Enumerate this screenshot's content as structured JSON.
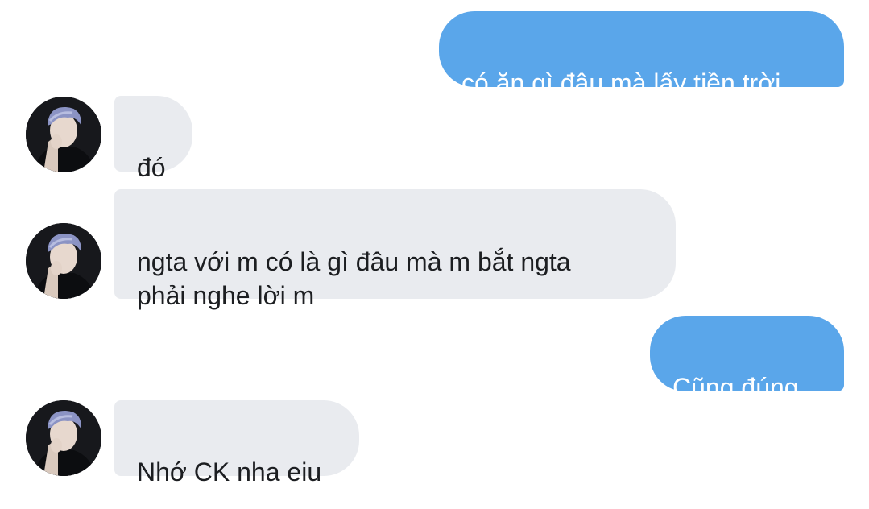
{
  "chat": {
    "messages": [
      {
        "direction": "outgoing",
        "text": "có ăn gì đâu mà lấy tiền trời"
      },
      {
        "direction": "incoming",
        "text": "đó"
      },
      {
        "direction": "incoming",
        "text": "ngta với m có là gì đâu mà m bắt ngta\nphải nghe lời m"
      },
      {
        "direction": "outgoing",
        "text": "Cũng đúng"
      },
      {
        "direction": "incoming",
        "text": "Nhớ CK nha eiu"
      }
    ]
  },
  "contact": {
    "avatar_icon": "contact-avatar-photo"
  },
  "colors": {
    "outgoing_bubble": "#5aa6ea",
    "incoming_bubble": "#e9ebef",
    "outgoing_text": "#ffffff",
    "incoming_text": "#1c1e21",
    "background": "#ffffff"
  }
}
